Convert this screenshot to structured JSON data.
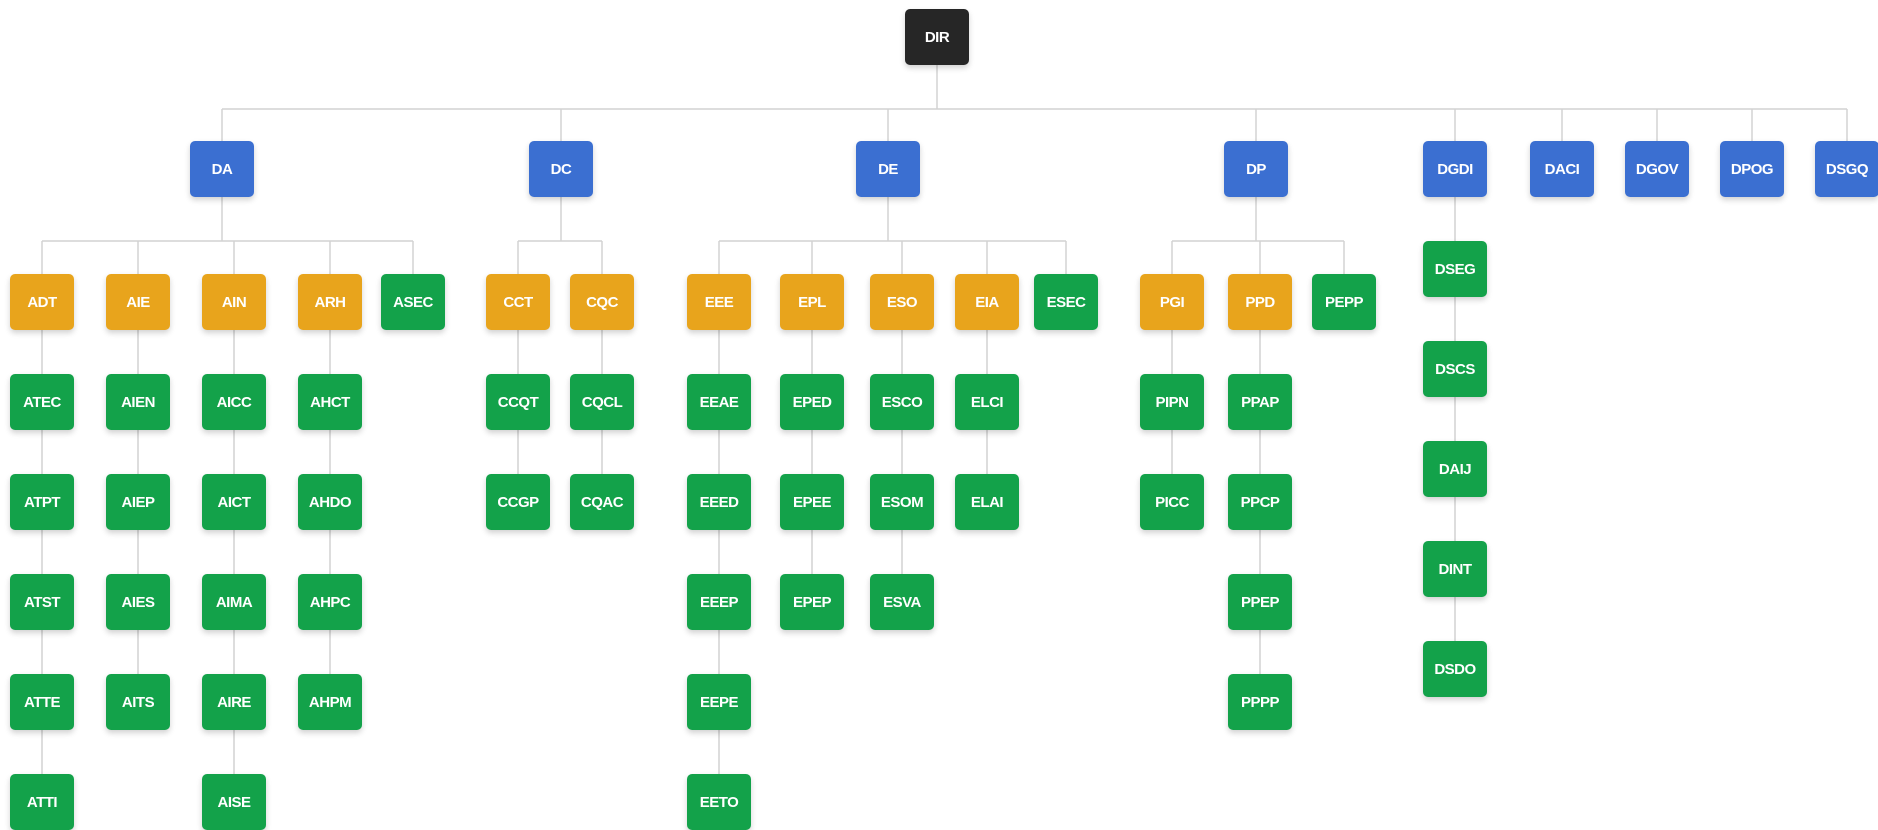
{
  "colors": {
    "root": "#262626",
    "division": "#3b6fd1",
    "group": "#e8a41c",
    "unit": "#13a24a",
    "connector": "#d2d2d2"
  },
  "root": {
    "label": "DIR",
    "kind": "root"
  },
  "divisions": [
    {
      "label": "DA",
      "columns": [
        {
          "head": {
            "label": "ADT",
            "kind": "group"
          },
          "items": [
            "ATEC",
            "ATPT",
            "ATST",
            "ATTE",
            "ATTI"
          ]
        },
        {
          "head": {
            "label": "AIE",
            "kind": "group"
          },
          "items": [
            "AIEN",
            "AIEP",
            "AIES",
            "AITS"
          ]
        },
        {
          "head": {
            "label": "AIN",
            "kind": "group"
          },
          "items": [
            "AICC",
            "AICT",
            "AIMA",
            "AIRE",
            "AISE"
          ]
        },
        {
          "head": {
            "label": "ARH",
            "kind": "group"
          },
          "items": [
            "AHCT",
            "AHDO",
            "AHPC",
            "AHPM"
          ]
        },
        {
          "head": {
            "label": "ASEC",
            "kind": "unit"
          },
          "items": []
        }
      ]
    },
    {
      "label": "DC",
      "columns": [
        {
          "head": {
            "label": "CCT",
            "kind": "group"
          },
          "items": [
            "CCQT",
            "CCGP"
          ]
        },
        {
          "head": {
            "label": "CQC",
            "kind": "group"
          },
          "items": [
            "CQCL",
            "CQAC"
          ]
        }
      ]
    },
    {
      "label": "DE",
      "columns": [
        {
          "head": {
            "label": "EEE",
            "kind": "group"
          },
          "items": [
            "EEAE",
            "EEED",
            "EEEP",
            "EEPE",
            "EETO"
          ]
        },
        {
          "head": {
            "label": "EPL",
            "kind": "group"
          },
          "items": [
            "EPED",
            "EPEE",
            "EPEP"
          ]
        },
        {
          "head": {
            "label": "ESO",
            "kind": "group"
          },
          "items": [
            "ESCO",
            "ESOM",
            "ESVA"
          ]
        },
        {
          "head": {
            "label": "EIA",
            "kind": "group"
          },
          "items": [
            "ELCI",
            "ELAI"
          ]
        },
        {
          "head": {
            "label": "ESEC",
            "kind": "unit"
          },
          "items": []
        }
      ]
    },
    {
      "label": "DP",
      "columns": [
        {
          "head": {
            "label": "PGI",
            "kind": "group"
          },
          "items": [
            "PIPN",
            "PICC"
          ]
        },
        {
          "head": {
            "label": "PPD",
            "kind": "group"
          },
          "items": [
            "PPAP",
            "PPCP",
            "PPEP",
            "PPPP"
          ]
        },
        {
          "head": {
            "label": "PEPP",
            "kind": "unit"
          },
          "items": []
        }
      ]
    },
    {
      "label": "DGDI",
      "stack": [
        "DSEG",
        "DSCS",
        "DAIJ",
        "DINT",
        "DSDO"
      ]
    },
    {
      "label": "DACI"
    },
    {
      "label": "DGOV"
    },
    {
      "label": "DPOG"
    },
    {
      "label": "DSGQ"
    }
  ]
}
